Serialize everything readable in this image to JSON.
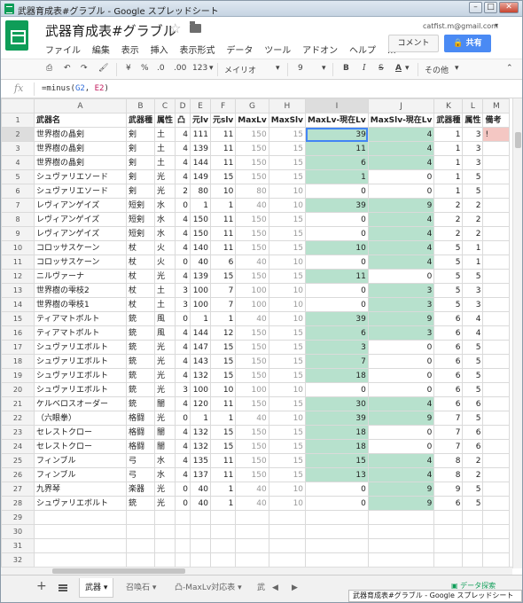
{
  "window": {
    "title": "武器育成表#グラブル - Google スプレッドシート"
  },
  "header": {
    "doc_title": "武器育成表#グラブル",
    "user_email": "catfist.m@gmail.com",
    "comment_label": "コメント",
    "share_label": "共有",
    "menus": [
      "ファイル",
      "編集",
      "表示",
      "挿入",
      "表示形式",
      "データ",
      "ツール",
      "アドオン",
      "ヘルプ",
      "…"
    ]
  },
  "toolbar": {
    "currency": "¥",
    "percent": "%",
    "dec_less": ".0",
    "dec_more": ".00",
    "format_more": "123",
    "font": "メイリオ",
    "size": "9",
    "bold": "B",
    "italic": "I",
    "strike": "S",
    "text_color": "A",
    "more": "その他"
  },
  "formula_bar": {
    "fx": "fx",
    "prefix": "=minus(",
    "ref1": "G2",
    "sep": ", ",
    "ref2": "E2",
    "suffix": ")"
  },
  "columns": [
    "",
    "A",
    "B",
    "C",
    "D",
    "E",
    "F",
    "G",
    "H",
    "I",
    "J",
    "K",
    "L",
    "M"
  ],
  "col_headers": [
    "武器名",
    "武器種",
    "属性",
    "凸",
    "元lv",
    "元slv",
    "MaxLv",
    "MaxSlv",
    "MaxLv-現在Lv",
    "MaxSlv-現在Lv",
    "武器種",
    "属性",
    "備考"
  ],
  "rows": [
    [
      "世界樹の晶剣",
      "剣",
      "土",
      "4",
      "111",
      "11",
      "150",
      "15",
      "39",
      "4",
      "1",
      "3",
      "!"
    ],
    [
      "世界樹の晶剣",
      "剣",
      "土",
      "4",
      "139",
      "11",
      "150",
      "15",
      "11",
      "4",
      "1",
      "3",
      ""
    ],
    [
      "世界樹の晶剣",
      "剣",
      "土",
      "4",
      "144",
      "11",
      "150",
      "15",
      "6",
      "4",
      "1",
      "3",
      ""
    ],
    [
      "シュヴァリエソード",
      "剣",
      "光",
      "4",
      "149",
      "15",
      "150",
      "15",
      "1",
      "0",
      "1",
      "5",
      ""
    ],
    [
      "シュヴァリエソード",
      "剣",
      "光",
      "2",
      "80",
      "10",
      "80",
      "10",
      "0",
      "0",
      "1",
      "5",
      ""
    ],
    [
      "レヴィアンゲイズ",
      "短剣",
      "水",
      "0",
      "1",
      "1",
      "40",
      "10",
      "39",
      "9",
      "2",
      "2",
      ""
    ],
    [
      "レヴィアンゲイズ",
      "短剣",
      "水",
      "4",
      "150",
      "11",
      "150",
      "15",
      "0",
      "4",
      "2",
      "2",
      ""
    ],
    [
      "レヴィアンゲイズ",
      "短剣",
      "水",
      "4",
      "150",
      "11",
      "150",
      "15",
      "0",
      "4",
      "2",
      "2",
      ""
    ],
    [
      "コロッサスケーン",
      "杖",
      "火",
      "4",
      "140",
      "11",
      "150",
      "15",
      "10",
      "4",
      "5",
      "1",
      ""
    ],
    [
      "コロッサスケーン",
      "杖",
      "火",
      "0",
      "40",
      "6",
      "40",
      "10",
      "0",
      "4",
      "5",
      "1",
      ""
    ],
    [
      "ニルヴァーナ",
      "杖",
      "光",
      "4",
      "139",
      "15",
      "150",
      "15",
      "11",
      "0",
      "5",
      "5",
      ""
    ],
    [
      "世界樹の雫枝2",
      "杖",
      "土",
      "3",
      "100",
      "7",
      "100",
      "10",
      "0",
      "3",
      "5",
      "3",
      ""
    ],
    [
      "世界樹の雫枝1",
      "杖",
      "土",
      "3",
      "100",
      "7",
      "100",
      "10",
      "0",
      "3",
      "5",
      "3",
      ""
    ],
    [
      "ティアマトボルト",
      "銃",
      "風",
      "0",
      "1",
      "1",
      "40",
      "10",
      "39",
      "9",
      "6",
      "4",
      ""
    ],
    [
      "ティアマトボルト",
      "銃",
      "風",
      "4",
      "144",
      "12",
      "150",
      "15",
      "6",
      "3",
      "6",
      "4",
      ""
    ],
    [
      "シュヴァリエボルト",
      "銃",
      "光",
      "4",
      "147",
      "15",
      "150",
      "15",
      "3",
      "0",
      "6",
      "5",
      ""
    ],
    [
      "シュヴァリエボルト",
      "銃",
      "光",
      "4",
      "143",
      "15",
      "150",
      "15",
      "7",
      "0",
      "6",
      "5",
      ""
    ],
    [
      "シュヴァリエボルト",
      "銃",
      "光",
      "4",
      "132",
      "15",
      "150",
      "15",
      "18",
      "0",
      "6",
      "5",
      ""
    ],
    [
      "シュヴァリエボルト",
      "銃",
      "光",
      "3",
      "100",
      "10",
      "100",
      "10",
      "0",
      "0",
      "6",
      "5",
      ""
    ],
    [
      "ケルベロスオーダー",
      "銃",
      "闇",
      "4",
      "120",
      "11",
      "150",
      "15",
      "30",
      "4",
      "6",
      "6",
      ""
    ],
    [
      "（六眼拳）",
      "格闘",
      "光",
      "0",
      "1",
      "1",
      "40",
      "10",
      "39",
      "9",
      "7",
      "5",
      ""
    ],
    [
      "セレストクロー",
      "格闘",
      "闇",
      "4",
      "132",
      "15",
      "150",
      "15",
      "18",
      "0",
      "7",
      "6",
      ""
    ],
    [
      "セレストクロー",
      "格闘",
      "闇",
      "4",
      "132",
      "15",
      "150",
      "15",
      "18",
      "0",
      "7",
      "6",
      ""
    ],
    [
      "フィンブル",
      "弓",
      "水",
      "4",
      "135",
      "11",
      "150",
      "15",
      "15",
      "4",
      "8",
      "2",
      ""
    ],
    [
      "フィンブル",
      "弓",
      "水",
      "4",
      "137",
      "11",
      "150",
      "15",
      "13",
      "4",
      "8",
      "2",
      ""
    ],
    [
      "九界琴",
      "楽器",
      "光",
      "0",
      "40",
      "1",
      "40",
      "10",
      "0",
      "9",
      "9",
      "5",
      ""
    ],
    [
      "シュヴァリエボルト",
      "銃",
      "光",
      "0",
      "40",
      "1",
      "40",
      "10",
      "0",
      "9",
      "6",
      "5",
      ""
    ]
  ],
  "empty_row_numbers": [
    "29",
    "30",
    "31",
    "32"
  ],
  "sheet_tabs": [
    "武器",
    "召喚石",
    "凸-MaxLv対応表",
    "武"
  ],
  "explore_label": "データ探索",
  "taskbar_label": "武器育成表#グラブル - Google スプレッドシート",
  "colors": {
    "green_fill": "#b7e1cd",
    "pink_fill": "#f4c7c3",
    "share_blue": "#4a8af4",
    "sheets_green": "#0f9d58"
  }
}
